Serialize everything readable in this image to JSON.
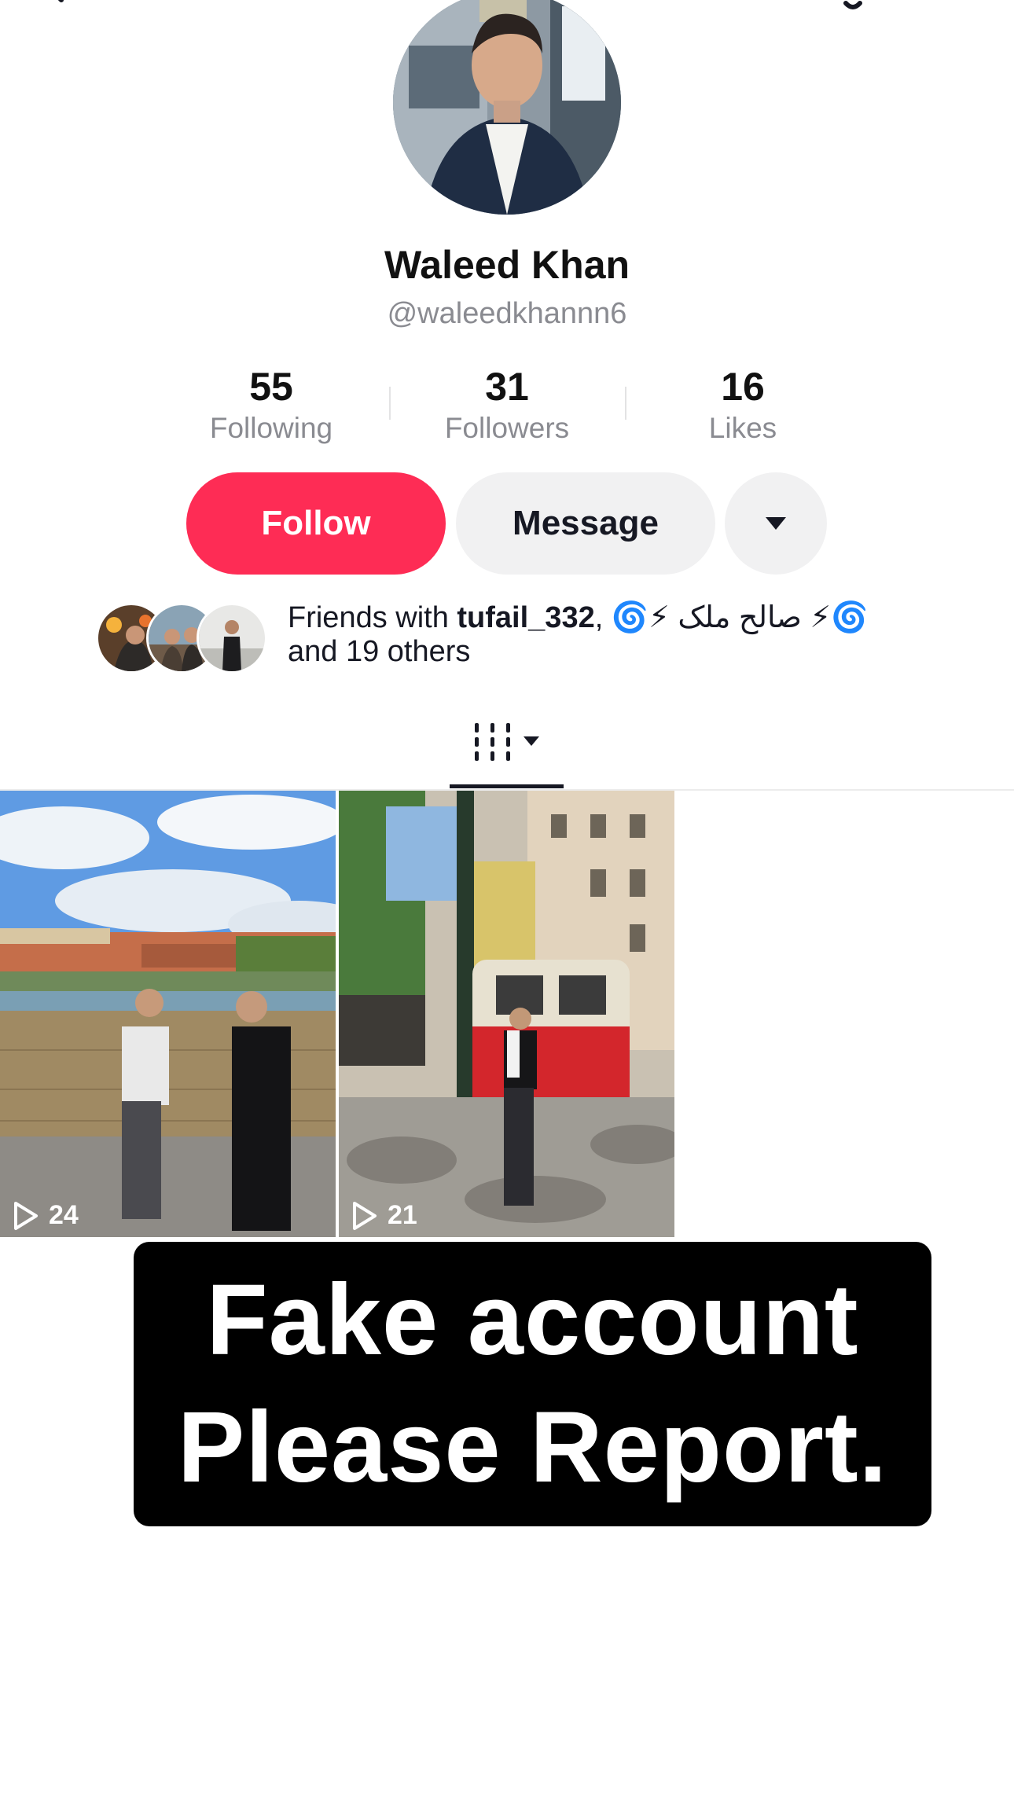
{
  "profile": {
    "name": "Waleed Khan",
    "handle": "@waleedkhannn6"
  },
  "stats": [
    {
      "value": "55",
      "label": "Following"
    },
    {
      "value": "31",
      "label": "Followers"
    },
    {
      "value": "16",
      "label": "Likes"
    }
  ],
  "actions": {
    "follow": "Follow",
    "message": "Message"
  },
  "friends": {
    "prefix": "Friends with ",
    "highlighted": "tufail_332",
    "sep": ", ",
    "second": "🌀⚡ صالح ملک ⚡🌀",
    "line2": "and 19 others"
  },
  "videos": [
    {
      "views": "24"
    },
    {
      "views": "21"
    }
  ],
  "overlay": {
    "line1": "Fake account",
    "line2": "Please Report."
  },
  "colors": {
    "accent": "#fe2c55",
    "secondary_button": "#f1f1f2"
  }
}
